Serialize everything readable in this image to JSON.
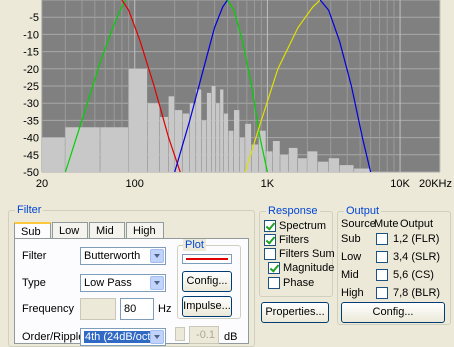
{
  "chart_data": {
    "type": "line",
    "x_scale": "log",
    "xlim": [
      20,
      20000
    ],
    "ylim": [
      -50,
      0
    ],
    "x_ticks": [
      "20",
      "100",
      "1K",
      "10K",
      "20KHz"
    ],
    "x_tick_values": [
      20,
      100,
      1000,
      10000,
      20000
    ],
    "y_ticks": [
      "-5",
      "-10",
      "-15",
      "-20",
      "-25",
      "-30",
      "-35",
      "-40",
      "-45",
      "-50"
    ],
    "y_tick_values": [
      -5,
      -10,
      -15,
      -20,
      -25,
      -30,
      -35,
      -40,
      -45,
      -50
    ],
    "grid": true,
    "background": "#808080",
    "series": [
      {
        "color": "#00d000",
        "x": [
          30,
          40,
          55,
          70,
          80,
          85
        ],
        "y": [
          -50,
          -35,
          -18,
          -7,
          -2,
          0
        ]
      },
      {
        "color": "#e00000",
        "x": [
          80,
          90,
          110,
          140,
          180,
          220
        ],
        "y": [
          0,
          -3,
          -12,
          -25,
          -40,
          -50
        ]
      },
      {
        "color": "#0000e0",
        "x": [
          200,
          260,
          330,
          400,
          460,
          500
        ],
        "y": [
          -50,
          -35,
          -20,
          -8,
          -2,
          0
        ]
      },
      {
        "color": "#00d000",
        "x": [
          500,
          560,
          650,
          760,
          880,
          1000
        ],
        "y": [
          0,
          -3,
          -12,
          -25,
          -40,
          -50
        ]
      },
      {
        "color": "#e0e000",
        "x": [
          680,
          900,
          1200,
          1700,
          2200,
          2500
        ],
        "y": [
          -50,
          -35,
          -20,
          -8,
          -2,
          0
        ]
      },
      {
        "color": "#0000e0",
        "x": [
          2500,
          2900,
          3500,
          4300,
          5200,
          6000
        ],
        "y": [
          0,
          -3,
          -12,
          -25,
          -40,
          -50
        ]
      }
    ],
    "spectrum_bars": [
      {
        "x0": 20,
        "x1": 30,
        "y": -40
      },
      {
        "x0": 30,
        "x1": 55,
        "y": -37
      },
      {
        "x0": 55,
        "x1": 90,
        "y": -37
      },
      {
        "x0": 90,
        "x1": 125,
        "y": -20
      },
      {
        "x0": 125,
        "x1": 155,
        "y": -30
      },
      {
        "x0": 155,
        "x1": 180,
        "y": -34
      },
      {
        "x0": 180,
        "x1": 200,
        "y": -28
      },
      {
        "x0": 200,
        "x1": 230,
        "y": -32
      },
      {
        "x0": 230,
        "x1": 260,
        "y": -33
      },
      {
        "x0": 260,
        "x1": 290,
        "y": -30
      },
      {
        "x0": 290,
        "x1": 320,
        "y": -26
      },
      {
        "x0": 320,
        "x1": 350,
        "y": -35
      },
      {
        "x0": 350,
        "x1": 380,
        "y": -27
      },
      {
        "x0": 380,
        "x1": 410,
        "y": -25
      },
      {
        "x0": 410,
        "x1": 440,
        "y": -30
      },
      {
        "x0": 440,
        "x1": 470,
        "y": -26
      },
      {
        "x0": 470,
        "x1": 510,
        "y": -33
      },
      {
        "x0": 510,
        "x1": 560,
        "y": -38
      },
      {
        "x0": 560,
        "x1": 620,
        "y": -32
      },
      {
        "x0": 620,
        "x1": 680,
        "y": -40
      },
      {
        "x0": 680,
        "x1": 760,
        "y": -36
      },
      {
        "x0": 760,
        "x1": 860,
        "y": -42
      },
      {
        "x0": 860,
        "x1": 980,
        "y": -38
      },
      {
        "x0": 980,
        "x1": 1100,
        "y": -44
      },
      {
        "x0": 1100,
        "x1": 1250,
        "y": -41
      },
      {
        "x0": 1250,
        "x1": 1450,
        "y": -45
      },
      {
        "x0": 1450,
        "x1": 1700,
        "y": -43
      },
      {
        "x0": 1700,
        "x1": 2000,
        "y": -46
      },
      {
        "x0": 2000,
        "x1": 2400,
        "y": -44
      },
      {
        "x0": 2400,
        "x1": 2900,
        "y": -47
      },
      {
        "x0": 2900,
        "x1": 3500,
        "y": -46
      },
      {
        "x0": 3500,
        "x1": 4500,
        "y": -48
      },
      {
        "x0": 4500,
        "x1": 6000,
        "y": -49
      }
    ]
  },
  "filter_group": {
    "title": "Filter",
    "tabs": [
      "Sub",
      "Low",
      "Mid",
      "High"
    ],
    "active_tab": "Sub",
    "filter_label": "Filter",
    "filter_value": "Butterworth",
    "type_label": "Type",
    "type_value": "Low Pass",
    "frequency_label": "Frequency",
    "frequency_value": "80",
    "frequency_unit": "Hz",
    "order_label": "Order/Ripple",
    "order_value": "4th (24dB/oct)",
    "ripple_value": "-0.1",
    "ripple_unit": "dB"
  },
  "plot_group": {
    "title": "Plot",
    "line_color": "#e00000",
    "config_label": "Config...",
    "impulse_label": "Impulse..."
  },
  "response_group": {
    "title": "Response",
    "items": [
      {
        "label": "Spectrum",
        "checked": true
      },
      {
        "label": "Filters",
        "checked": true
      },
      {
        "label": "Filters Sum",
        "checked": false
      },
      {
        "label": "Magnitude",
        "checked": true
      },
      {
        "label": "Phase",
        "checked": false
      }
    ],
    "properties_label": "Properties..."
  },
  "output_group": {
    "title": "Output",
    "headers": {
      "source": "Source",
      "mute": "Mute",
      "output": "Output"
    },
    "rows": [
      {
        "source": "Sub",
        "muted": false,
        "output": "1,2 (FLR)"
      },
      {
        "source": "Low",
        "muted": false,
        "output": "3,4 (SLR)"
      },
      {
        "source": "Mid",
        "muted": false,
        "output": "5,6 (CS)"
      },
      {
        "source": "High",
        "muted": false,
        "output": "7,8 (BLR)"
      }
    ],
    "config_label": "Config..."
  }
}
